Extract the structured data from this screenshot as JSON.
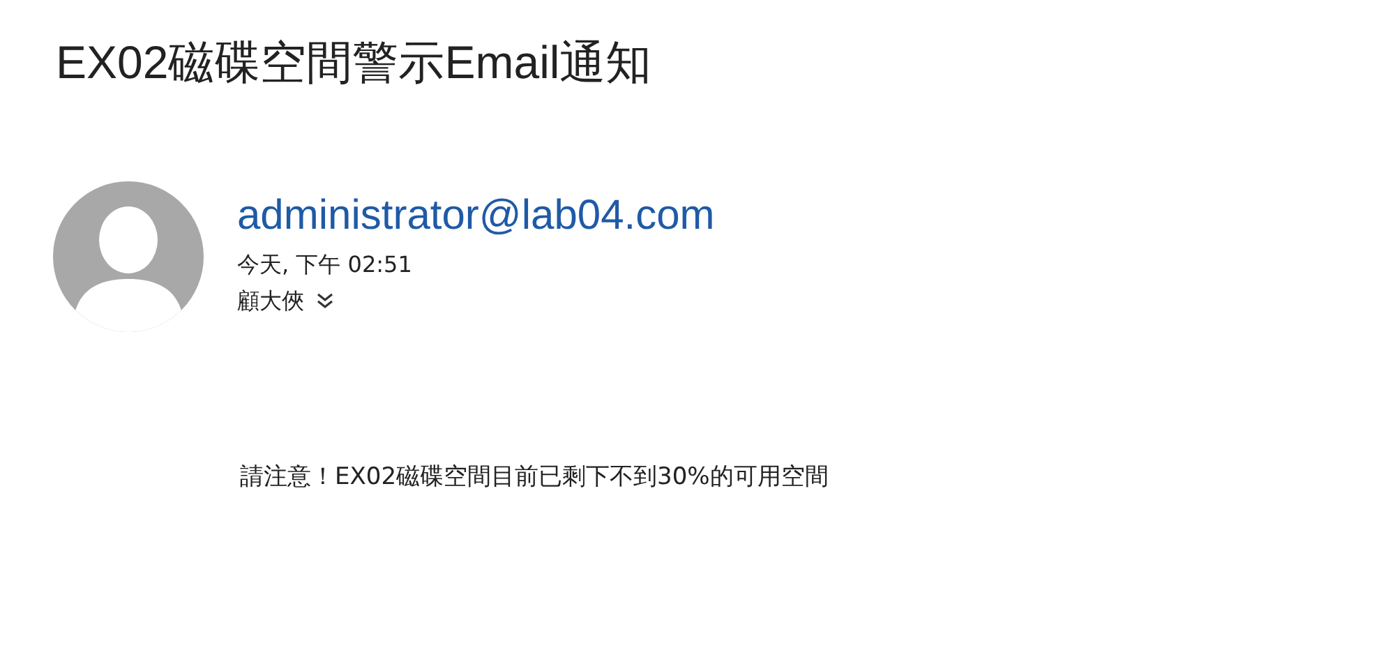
{
  "subject": "EX02磁碟空間警示Email通知",
  "sender": {
    "address": "administrator@lab04.com",
    "time": "今天, 下午 02:51",
    "recipient": "顧大俠"
  },
  "body": "請注意！EX02磁碟空間目前已剩下不到30%的可用空間"
}
